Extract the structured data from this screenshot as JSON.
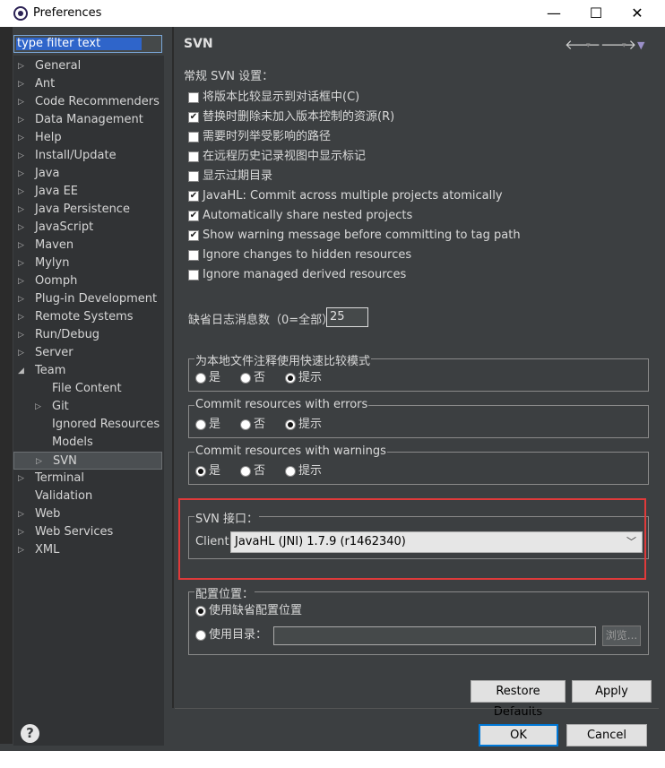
{
  "window": {
    "title": "Preferences",
    "minimize_glyph": "—",
    "maximize_glyph": "☐",
    "close_glyph": "✕"
  },
  "filter": {
    "value": "type filter text"
  },
  "tree": {
    "items": [
      {
        "label": "General",
        "expandable": true,
        "level": 0
      },
      {
        "label": "Ant",
        "expandable": true,
        "level": 0
      },
      {
        "label": "Code Recommenders",
        "expandable": true,
        "level": 0
      },
      {
        "label": "Data Management",
        "expandable": true,
        "level": 0
      },
      {
        "label": "Help",
        "expandable": true,
        "level": 0
      },
      {
        "label": "Install/Update",
        "expandable": true,
        "level": 0
      },
      {
        "label": "Java",
        "expandable": true,
        "level": 0
      },
      {
        "label": "Java EE",
        "expandable": true,
        "level": 0
      },
      {
        "label": "Java Persistence",
        "expandable": true,
        "level": 0
      },
      {
        "label": "JavaScript",
        "expandable": true,
        "level": 0
      },
      {
        "label": "Maven",
        "expandable": true,
        "level": 0
      },
      {
        "label": "Mylyn",
        "expandable": true,
        "level": 0
      },
      {
        "label": "Oomph",
        "expandable": true,
        "level": 0
      },
      {
        "label": "Plug-in Development",
        "expandable": true,
        "level": 0
      },
      {
        "label": "Remote Systems",
        "expandable": true,
        "level": 0
      },
      {
        "label": "Run/Debug",
        "expandable": true,
        "level": 0
      },
      {
        "label": "Server",
        "expandable": true,
        "level": 0
      },
      {
        "label": "Team",
        "expandable": true,
        "expanded": true,
        "level": 0
      },
      {
        "label": "File Content",
        "expandable": false,
        "level": 1
      },
      {
        "label": "Git",
        "expandable": true,
        "level": 1
      },
      {
        "label": "Ignored Resources",
        "expandable": false,
        "level": 1
      },
      {
        "label": "Models",
        "expandable": false,
        "level": 1
      },
      {
        "label": "SVN",
        "expandable": true,
        "level": 1,
        "selected": true
      },
      {
        "label": "Terminal",
        "expandable": true,
        "level": 0
      },
      {
        "label": "Validation",
        "expandable": false,
        "level": 0
      },
      {
        "label": "Web",
        "expandable": true,
        "level": 0
      },
      {
        "label": "Web Services",
        "expandable": true,
        "level": 0
      },
      {
        "label": "XML",
        "expandable": true,
        "level": 0
      }
    ]
  },
  "pane": {
    "title": "SVN",
    "section_label": "常规 SVN 设置：",
    "checkboxes": [
      {
        "label": "将版本比较显示到对话框中(C)",
        "checked": false
      },
      {
        "label": "替换时删除未加入版本控制的资源(R)",
        "checked": true
      },
      {
        "label": "需要时列举受影响的路径",
        "checked": false
      },
      {
        "label": "在远程历史记录视图中显示标记",
        "checked": false
      },
      {
        "label": "显示过期目录",
        "checked": false
      },
      {
        "label": "JavaHL: Commit across multiple projects atomically",
        "checked": true
      },
      {
        "label": "Automatically share nested projects",
        "checked": true
      },
      {
        "label": "Show warning message before committing to tag path",
        "checked": true
      },
      {
        "label": "Ignore changes to hidden resources",
        "checked": false
      },
      {
        "label": "Ignore managed derived resources",
        "checked": false
      }
    ],
    "log_label": "缺省日志消息数（0=全部）",
    "log_value": "25",
    "groups": [
      {
        "legend": "为本地文件注释使用快速比较模式",
        "options": [
          "是",
          "否",
          "提示"
        ],
        "selected": 2
      },
      {
        "legend": "Commit resources with errors",
        "options": [
          "是",
          "否",
          "提示"
        ],
        "selected": 2
      },
      {
        "legend": "Commit resources with warnings",
        "options": [
          "是",
          "否",
          "提示"
        ],
        "selected": 0
      }
    ],
    "svn_interface": {
      "legend": "SVN 接口：",
      "client_label": "Client:",
      "client_value": "JavaHL (JNI) 1.7.9 (r1462340)"
    },
    "config_location": {
      "legend": "配置位置：",
      "use_default": "使用缺省配置位置",
      "use_dir": "使用目录：",
      "dir_value": "",
      "browse_label": "浏览..."
    },
    "restore_defaults": "Restore Defaults",
    "apply": "Apply"
  },
  "footer": {
    "help_glyph": "?",
    "ok": "OK",
    "cancel": "Cancel"
  },
  "colors": {
    "accent": "#0078d7",
    "highlight_box": "#e03a3a",
    "selection": "#2f65ca"
  }
}
